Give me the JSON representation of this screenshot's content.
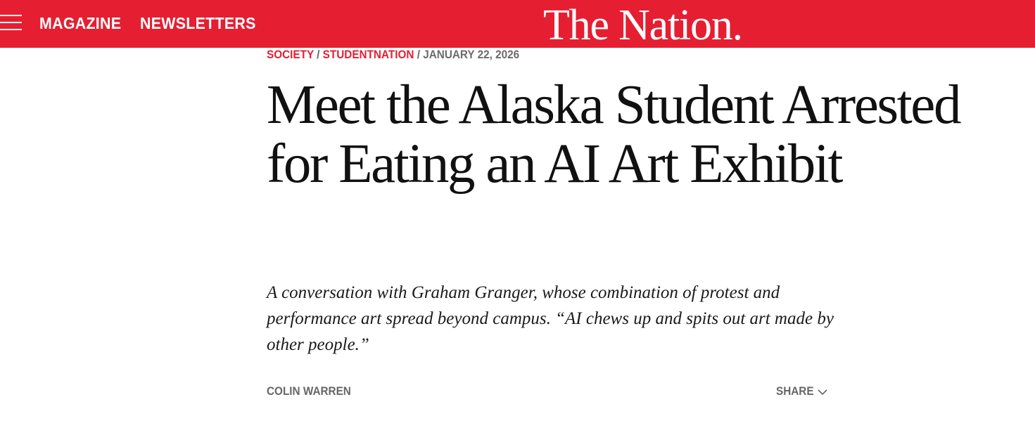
{
  "header": {
    "menu_icon": "hamburger-menu-icon",
    "nav": [
      "MAGAZINE",
      "NEWSLETTERS"
    ],
    "logo": "The Nation.",
    "brand_color": "#e61e31"
  },
  "article": {
    "kicker": {
      "categories": [
        "SOCIETY",
        "STUDENTNATION"
      ],
      "separator": "/",
      "date": "JANUARY 22, 2026"
    },
    "headline": "Meet the Alaska Student Arrested for Eating an AI Art Exhibit",
    "dek": "A conversation with Graham Granger, whose combination of protest and performance art spread beyond campus. “AI chews up and spits out art made by other people.”",
    "author": "COLIN WARREN",
    "share": {
      "label": "SHARE",
      "icon": "chevron-down-icon"
    }
  }
}
